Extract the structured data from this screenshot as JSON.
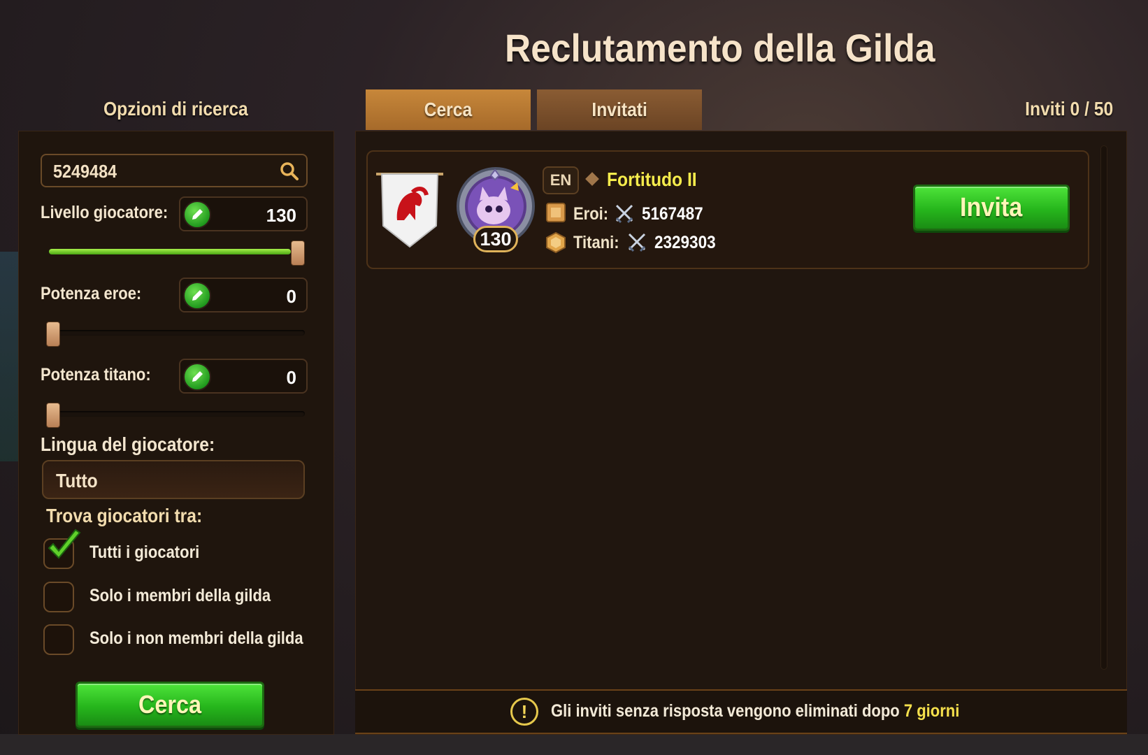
{
  "header": {
    "title": "Reclutamento della Gilda"
  },
  "search_options": {
    "label": "Opzioni di ricerca",
    "search_value": "5249484",
    "player_level": {
      "label": "Livello giocatore:",
      "value": "130",
      "slider_fraction": 1.0
    },
    "hero_power": {
      "label": "Potenza eroe:",
      "value": "0",
      "slider_fraction": 0.0
    },
    "titan_power": {
      "label": "Potenza titano:",
      "value": "0",
      "slider_fraction": 0.0
    },
    "language": {
      "label": "Lingua del giocatore:",
      "value": "Tutto"
    },
    "find_among": {
      "label": "Trova giocatori tra:",
      "options": [
        {
          "label": "Tutti i giocatori",
          "checked": true
        },
        {
          "label": "Solo i membri della gilda",
          "checked": false
        },
        {
          "label": "Solo i non membri della gilda",
          "checked": false
        }
      ]
    },
    "search_button": "Cerca"
  },
  "tabs": [
    {
      "label": "Cerca",
      "active": true
    },
    {
      "label": "Invitati",
      "active": false
    }
  ],
  "invites_count": "Inviti 0 / 50",
  "player": {
    "level": "130",
    "lang": "EN",
    "name": "Fortitudo  II",
    "heroes_label": "Eroi:",
    "heroes_power": "5167487",
    "titans_label": "Titani:",
    "titans_power": "2329303",
    "invite_button": "Invita"
  },
  "footer": {
    "text_prefix": "Gli inviti senza risposta vengono eliminati dopo",
    "text_highlight": "7 giorni"
  },
  "colors": {
    "accent_green": "#26b61c",
    "tab_active": "#c7873a",
    "player_name": "#f5ec4c"
  }
}
